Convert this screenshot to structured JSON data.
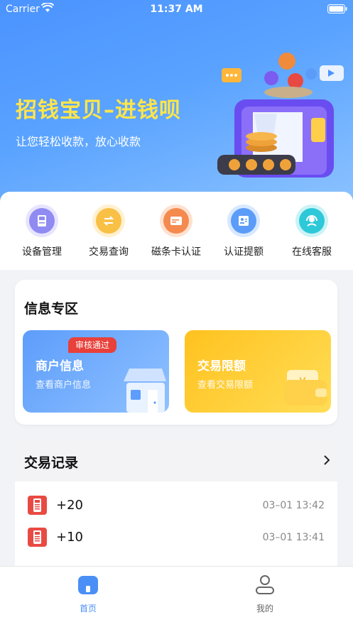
{
  "status_bar": {
    "carrier": "Carrier",
    "time": "11:37 AM"
  },
  "hero": {
    "title": "招钱宝贝–进钱呗",
    "subtitle": "让您轻松收款，放心收款"
  },
  "quick_actions": [
    {
      "label": "设备管理",
      "icon": "device-icon",
      "color": "#8f8bf2"
    },
    {
      "label": "交易查询",
      "icon": "exchange-icon",
      "color": "#f9c046"
    },
    {
      "label": "磁条卡认证",
      "icon": "card-icon",
      "color": "#f58a4f"
    },
    {
      "label": "认证提额",
      "icon": "id-card-icon",
      "color": "#5a9cf8"
    },
    {
      "label": "在线客服",
      "icon": "headset-icon",
      "color": "#2ec9d8"
    }
  ],
  "info_zone": {
    "title": "信息专区",
    "merchant": {
      "badge": "审核通过",
      "title": "商户信息",
      "subtitle": "查看商户信息"
    },
    "limit": {
      "title": "交易限额",
      "subtitle": "查看交易限额"
    }
  },
  "transactions": {
    "title": "交易记录",
    "rows": [
      {
        "amount": "+20",
        "datetime": "03–01 13:42"
      },
      {
        "amount": "+10",
        "datetime": "03–01 13:41"
      }
    ]
  },
  "tabbar": {
    "home": "首页",
    "mine": "我的"
  },
  "colors": {
    "accent": "#4a8ff5",
    "hero_title": "#ffe54a",
    "badge": "#e8403a"
  }
}
